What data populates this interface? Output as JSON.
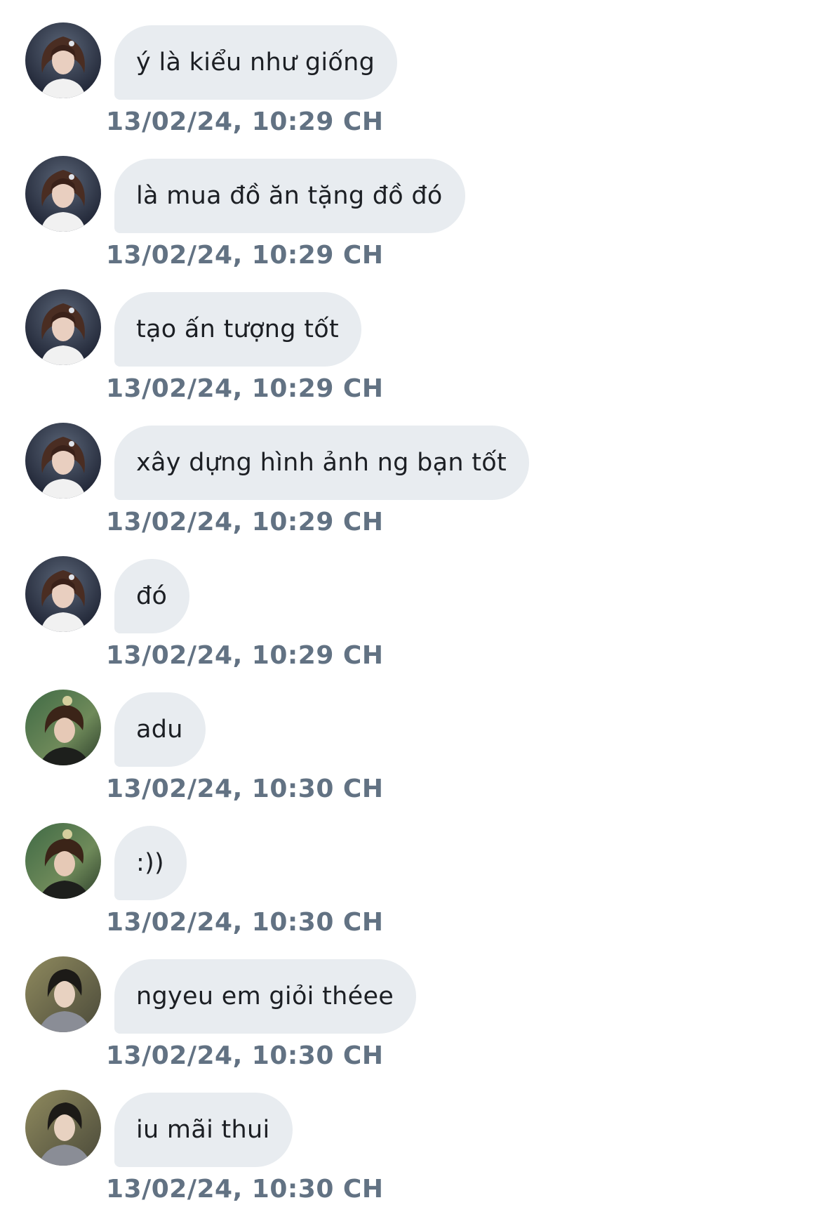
{
  "colors": {
    "background": "#ffffff",
    "bubble": "#e8ecf0",
    "message_text": "#1c1f24",
    "timestamp_text": "#627283"
  },
  "messages": [
    {
      "avatar": "user-a-avatar",
      "text": "ý là kiểu như giống",
      "time": "13/02/24, 10:29 CH"
    },
    {
      "avatar": "user-a-avatar",
      "text": "là mua đồ ăn tặng đồ đó",
      "time": "13/02/24, 10:29 CH"
    },
    {
      "avatar": "user-a-avatar",
      "text": "tạo ấn tượng tốt",
      "time": "13/02/24, 10:29 CH"
    },
    {
      "avatar": "user-a-avatar",
      "text": "xây dựng hình ảnh ng bạn tốt",
      "time": "13/02/24, 10:29 CH"
    },
    {
      "avatar": "user-a-avatar",
      "text": "đó",
      "time": "13/02/24, 10:29 CH"
    },
    {
      "avatar": "user-b-avatar",
      "text": "adu",
      "time": "13/02/24, 10:30 CH"
    },
    {
      "avatar": "user-b-avatar",
      "text": ":))",
      "time": "13/02/24, 10:30 CH"
    },
    {
      "avatar": "user-c-avatar",
      "text": "ngyeu em giỏi théee",
      "time": "13/02/24, 10:30 CH"
    },
    {
      "avatar": "user-c-avatar",
      "text": "iu mãi thui",
      "time": "13/02/24, 10:30 CH"
    }
  ]
}
